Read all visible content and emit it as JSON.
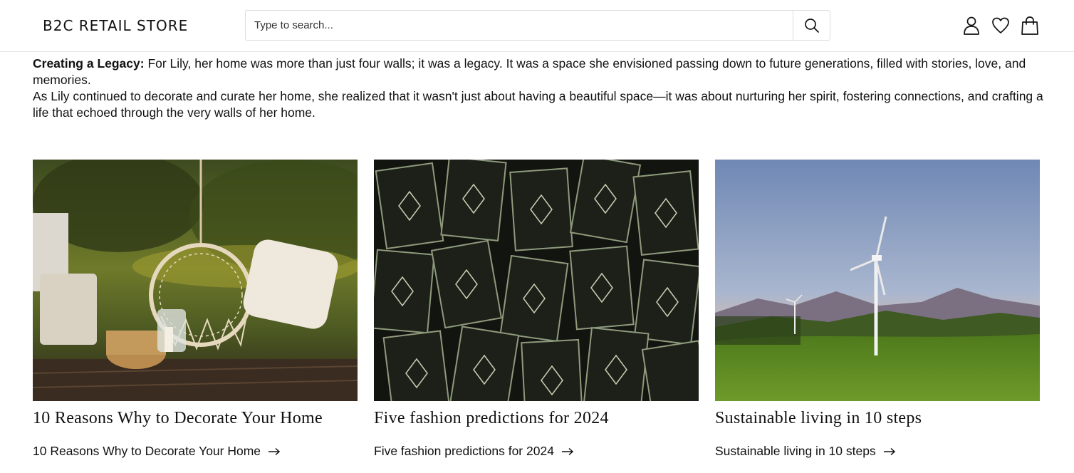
{
  "header": {
    "logo": "B2C RETAIL STORE",
    "search_placeholder": "Type to search...",
    "icons": [
      "search-icon",
      "user-icon",
      "heart-icon",
      "bag-icon"
    ]
  },
  "article": {
    "legacy_heading": "Creating a Legacy:",
    "legacy_text": " For Lily, her home was more than just four walls; it was a legacy. It was a space she envisioned passing down to future generations, filled with stories, love, and memories.",
    "closing_text": "As Lily continued to decorate and curate her home, she realized that it wasn't just about having a beautiful space—it was about nurturing her spirit, fostering connections, and crafting a life that echoed through the very walls of her home."
  },
  "cards": [
    {
      "title": "10 Reasons Why to Decorate Your Home",
      "link": "10 Reasons Why to Decorate Your Home"
    },
    {
      "title": "Five fashion predictions for 2024",
      "link": "Five fashion predictions for 2024"
    },
    {
      "title": "Sustainable living in 10 steps",
      "link": "Sustainable living in 10 steps"
    }
  ],
  "colors": {
    "text": "#111111",
    "border": "#dcdcdc",
    "background": "#ffffff"
  }
}
